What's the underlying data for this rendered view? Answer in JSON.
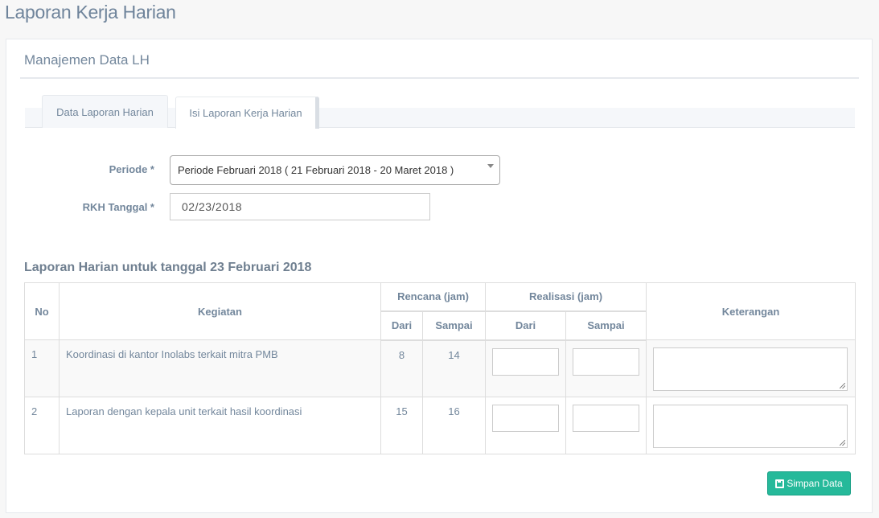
{
  "page_title": "Laporan Kerja Harian",
  "panel_title": "Manajemen Data LH",
  "tabs": [
    {
      "label": "Data Laporan Harian",
      "active": false
    },
    {
      "label": "Isi Laporan Kerja Harian",
      "active": true
    }
  ],
  "form": {
    "periode_label": "Periode *",
    "periode_value": "Periode Februari 2018 ( 21 Februari 2018 - 20 Maret 2018 )",
    "tanggal_label": "RKH Tanggal *",
    "tanggal_value": "02/23/2018"
  },
  "table": {
    "heading": "Laporan Harian untuk tanggal 23 Februari 2018",
    "headers": {
      "no": "No",
      "kegiatan": "Kegiatan",
      "rencana": "Rencana (jam)",
      "realisasi": "Realisasi (jam)",
      "keterangan": "Keterangan",
      "dari": "Dari",
      "sampai": "Sampai"
    },
    "rows": [
      {
        "no": "1",
        "kegiatan": "Koordinasi di kantor Inolabs terkait mitra PMB",
        "dari": "8",
        "sampai": "14"
      },
      {
        "no": "2",
        "kegiatan": "Laporan dengan kepala unit terkait hasil koordinasi",
        "dari": "15",
        "sampai": "16"
      }
    ]
  },
  "save_button": {
    "label": "Simpan Data",
    "icon": "save-icon",
    "color": "#26B99A"
  }
}
